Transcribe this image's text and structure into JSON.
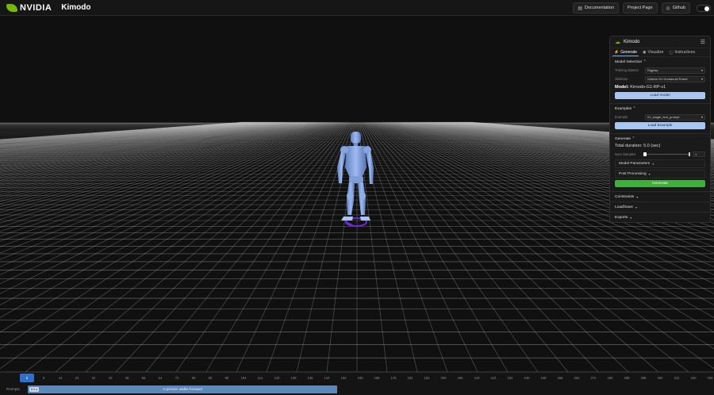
{
  "topbar": {
    "brand": "NVIDIA",
    "app_title": "Kimodo",
    "actions": [
      {
        "label": "Documentation",
        "icon": "doc-icon"
      },
      {
        "label": "Project Page",
        "icon": ""
      },
      {
        "label": "Github",
        "icon": "github-icon"
      }
    ]
  },
  "panel": {
    "title": "Kimodo",
    "tabs": [
      {
        "label": "Generate",
        "active": true
      },
      {
        "label": "Visualize",
        "active": false
      },
      {
        "label": "Instructions",
        "active": false
      }
    ],
    "model_selection": {
      "title": "Model Selection",
      "training_dataset_label": "Training dataset",
      "training_dataset_value": "Rigplay",
      "skeleton_label": "Skeleton",
      "skeleton_value": "Unitree G1 Humanoid Robot",
      "model_prefix": "Model:",
      "model_name": "Kimodo-G1-RP-v1",
      "load_button": "Load model"
    },
    "examples": {
      "title": "Examples",
      "example_label": "Example",
      "example_value": "01_single_text_prompt",
      "load_button": "Load Example"
    },
    "generate": {
      "title": "Generate",
      "total_duration": "Total duration: 5.0 (sec)",
      "num_samples_label": "Num Samples",
      "num_samples_value": "1",
      "model_parameters": "Model Parameters",
      "post_processing": "Post Processing",
      "generate_button": "Generate"
    },
    "constraints": "Constraints",
    "load_save": "Load/Save",
    "exports": "Exports"
  },
  "timeline": {
    "playhead_label": "0",
    "ticks": [
      "8",
      "16",
      "24",
      "32",
      "40",
      "48",
      "56",
      "64",
      "72",
      "80",
      "88",
      "96",
      "104",
      "112",
      "120",
      "128",
      "136",
      "144",
      "152",
      "160",
      "168",
      "176",
      "184",
      "192",
      "200",
      "208",
      "216",
      "224",
      "232",
      "240",
      "248",
      "256",
      "264",
      "272",
      "280",
      "288",
      "296",
      "304",
      "312",
      "320",
      "328"
    ],
    "prompts_label": "Prompts",
    "prompt": {
      "duration": "5.0 s",
      "text": "A person walks forward"
    }
  },
  "colors": {
    "accent_green": "#76b900",
    "button_blue": "#a9c6f0",
    "generate_green": "#3fae3c",
    "robot_blue": "#7d9fd6",
    "target_purple": "#6a2bd8"
  }
}
